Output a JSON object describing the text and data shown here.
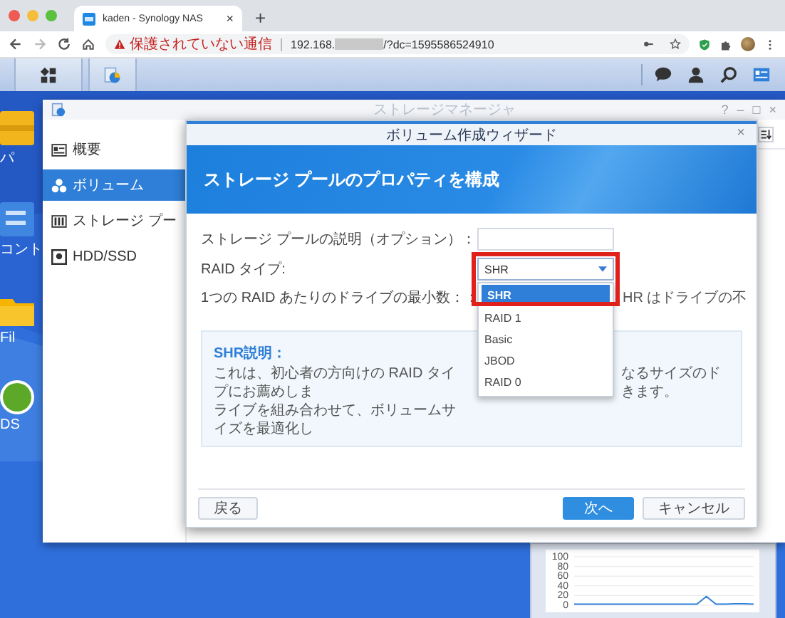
{
  "browser": {
    "tab_title": "kaden - Synology NAS",
    "tab_close": "×",
    "new_tab": "+",
    "security_warning": "保護されていない通信",
    "url_prefix": "192.168.",
    "url_suffix": "/?dc=1595586524910"
  },
  "desktop_icons": [
    {
      "label": "パ",
      "kind": "package"
    },
    {
      "label": "コント",
      "kind": "control"
    },
    {
      "label": "Fil",
      "kind": "file"
    },
    {
      "label": "DS",
      "kind": "ds"
    }
  ],
  "storage_manager": {
    "title": "ストレージマネージャ",
    "window_controls": [
      "?",
      "–",
      "□",
      "×"
    ],
    "sidebar": [
      {
        "label": "概要",
        "kind": "overview",
        "selected": false
      },
      {
        "label": "ボリューム",
        "kind": "volume",
        "selected": true
      },
      {
        "label": "ストレージ プー",
        "kind": "pool",
        "selected": false
      },
      {
        "label": "HDD/SSD",
        "kind": "disk",
        "selected": false
      }
    ]
  },
  "wizard": {
    "title": "ボリューム作成ウィザード",
    "close": "×",
    "heading": "ストレージ プールのプロパティを構成",
    "fields": [
      {
        "label": "ストレージ プールの説明（オプション）：",
        "kind": "input"
      },
      {
        "label": "RAID タイプ:",
        "kind": "select",
        "value": "SHR"
      },
      {
        "label": "1つの RAID あたりのドライブの最小数：：",
        "kind": "note",
        "value": "HR はドライブの不"
      }
    ],
    "dropdown_options": [
      {
        "label": "SHR",
        "selected": true
      },
      {
        "label": "RAID 1",
        "selected": false
      },
      {
        "label": "Basic",
        "selected": false
      },
      {
        "label": "JBOD",
        "selected": false
      },
      {
        "label": "RAID 0",
        "selected": false
      }
    ],
    "info": {
      "title": "SHR説明：",
      "left_lines": [
        "これは、初心者の方向けの RAID タイプにお薦めしま",
        "ライブを組み合わせて、ボリュームサイズを最適化し"
      ],
      "right_lines": [
        "なるサイズのド",
        "きます。"
      ]
    },
    "buttons": [
      {
        "label": "戻る",
        "kind": "secondary"
      },
      {
        "label": "次へ",
        "kind": "primary"
      },
      {
        "label": "キャンセル",
        "kind": "secondary"
      }
    ]
  },
  "widget": {
    "chart_data": {
      "type": "line",
      "ylim": [
        0,
        100
      ],
      "yticks": [
        0,
        20,
        40,
        60,
        80,
        100
      ],
      "grid": true,
      "series": [
        {
          "color": "#2f7fd8",
          "values": [
            2,
            2,
            2,
            2,
            2,
            2,
            2,
            2,
            2,
            2,
            2,
            2,
            2,
            2,
            18,
            2,
            2,
            3,
            3,
            2
          ]
        }
      ]
    }
  }
}
